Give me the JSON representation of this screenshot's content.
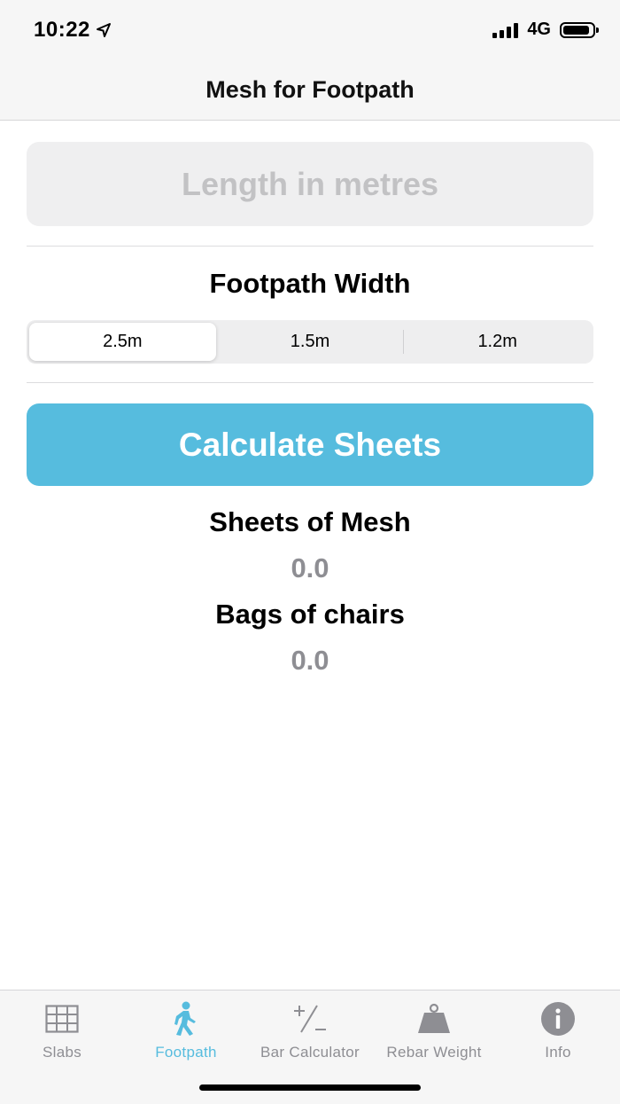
{
  "status_bar": {
    "time": "10:22",
    "network": "4G"
  },
  "nav": {
    "title": "Mesh for Footpath"
  },
  "length_input": {
    "placeholder": "Length in metres",
    "value": ""
  },
  "width_section": {
    "title": "Footpath Width",
    "options": [
      "2.5m",
      "1.5m",
      "1.2m"
    ],
    "selected": "2.5m"
  },
  "calculate_button": {
    "label": "Calculate Sheets"
  },
  "results": {
    "sheets_label": "Sheets of Mesh",
    "sheets_value": "0.0",
    "bags_label": "Bags of chairs",
    "bags_value": "0.0"
  },
  "tab_bar": {
    "items": [
      {
        "label": "Slabs",
        "icon": "grid-icon"
      },
      {
        "label": "Footpath",
        "icon": "walking-person-icon"
      },
      {
        "label": "Bar Calculator",
        "icon": "plus-minus-icon"
      },
      {
        "label": "Rebar Weight",
        "icon": "weight-icon"
      },
      {
        "label": "Info",
        "icon": "info-icon"
      }
    ],
    "active": "Footpath"
  },
  "colors": {
    "accent": "#56bcde",
    "inactive": "#8e8e93",
    "placeholder": "#c2c2c4",
    "bar_background": "#f6f6f6"
  }
}
